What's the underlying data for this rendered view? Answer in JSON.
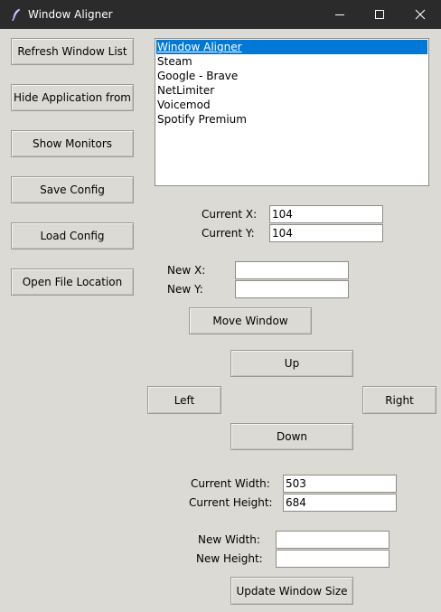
{
  "window": {
    "title": "Window Aligner"
  },
  "sidebar": {
    "refresh_label": "Refresh Window List",
    "hide_label": "Hide Application from",
    "show_monitors_label": "Show Monitors",
    "save_config_label": "Save Config",
    "load_config_label": "Load Config",
    "open_file_location_label": "Open File Location"
  },
  "window_list": {
    "items": [
      "Window Aligner",
      "Steam",
      "Google - Brave",
      "NetLimiter",
      "Voicemod",
      "Spotify Premium"
    ],
    "selected_index": 0
  },
  "position": {
    "current_x_label": "Current X:",
    "current_x_value": "104",
    "current_y_label": "Current Y:",
    "current_y_value": "104",
    "new_x_label": "New X:",
    "new_x_value": "",
    "new_y_label": "New Y:",
    "new_y_value": "",
    "move_label": "Move Window"
  },
  "nudge": {
    "up_label": "Up",
    "left_label": "Left",
    "right_label": "Right",
    "down_label": "Down"
  },
  "size": {
    "current_width_label": "Current Width:",
    "current_width_value": "503",
    "current_height_label": "Current Height:",
    "current_height_value": "684",
    "new_width_label": "New Width:",
    "new_width_value": "",
    "new_height_label": "New Height:",
    "new_height_value": "",
    "update_label": "Update Window Size"
  },
  "colors": {
    "background": "#dcdad5",
    "titlebar": "#2b2b2b",
    "selection": "#0078d7"
  }
}
